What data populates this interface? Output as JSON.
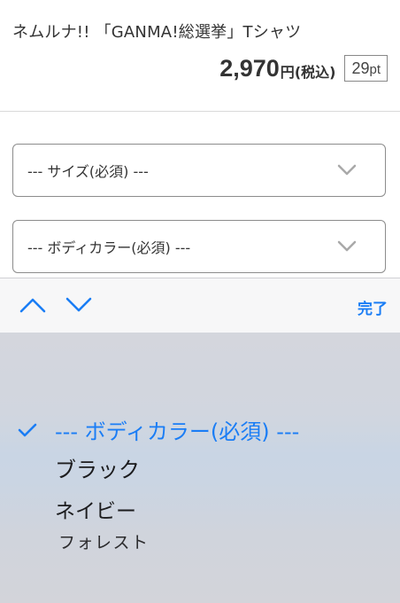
{
  "product": {
    "title": "ネムルナ!! 「GANMA!総選挙」Tシャツ",
    "price_amount": "2,970",
    "price_unit": "円",
    "price_tax": "(税込)",
    "points_value": "29",
    "points_unit": "pt"
  },
  "selects": {
    "size": {
      "label": "--- サイズ(必須) ---"
    },
    "body_color": {
      "label": "--- ボディカラー(必須) ---"
    }
  },
  "picker": {
    "done_label": "完了",
    "selected_index": 0,
    "options": [
      "--- ボディカラー(必須) ---",
      "ブラック",
      "ネイビー",
      "フォレスト"
    ]
  },
  "colors": {
    "accent": "#1a7df5",
    "text": "#333333",
    "border": "#8c8c8c",
    "toolbar_bg": "#f7f7f8",
    "wheel_bg": "#cfd5df"
  },
  "icons": {
    "select_chevron": "chevron-down-icon",
    "prev": "chevron-up-icon",
    "next": "chevron-down-icon",
    "check": "checkmark-icon"
  }
}
